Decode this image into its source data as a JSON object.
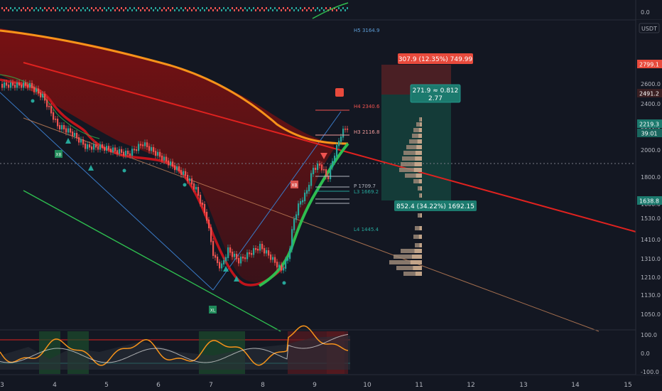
{
  "price_axis": {
    "currency": "USDT",
    "ticks": [
      "2600.0",
      "2400.0",
      "2200.0",
      "2000.0",
      "1800.0",
      "1600.0",
      "1530.0",
      "1410.0",
      "1310.0",
      "1210.0",
      "1130.0",
      "1050.0"
    ],
    "badge_red": "2799.1",
    "badge_dark": "2491.2",
    "badge_current": "2219.3",
    "badge_countdown": "39:01",
    "badge_stop": "1638.8"
  },
  "top_pane": {
    "value": "0.0"
  },
  "oscillator": {
    "ticks": [
      "100.0",
      "0.0",
      "-100.0"
    ]
  },
  "time_axis": {
    "labels": [
      "3",
      "4",
      "5",
      "6",
      "7",
      "8",
      "9",
      "10",
      "11",
      "12",
      "13",
      "14",
      "15"
    ]
  },
  "pivots": {
    "h5": "H5 3164.9",
    "h4": "H4 2340.6",
    "h3": "H3 2116.8",
    "p": "P 1709.7",
    "l3": "L3 1669.2",
    "l4": "L4 1445.4"
  },
  "position": {
    "target_label": "307.9 (12.35%) 749.99",
    "ratio_line1": "271.9 ≈ 0.812",
    "ratio_line2": "2.77",
    "stop_label": "852.4 (34.22%) 1692.15"
  },
  "markers": {
    "xb_1": "XB",
    "xb_2": "XB",
    "xl": "XL"
  },
  "colors": {
    "background": "#131722",
    "up": "#26a69a",
    "down": "#ef5350",
    "ema_orange": "#f7931a",
    "trend_red": "#e0221f",
    "channel_green": "#2ebd4f",
    "channel_blue": "#3a7bc8",
    "target_zone": "#4a1f24",
    "stop_zone": "#143b38"
  }
}
